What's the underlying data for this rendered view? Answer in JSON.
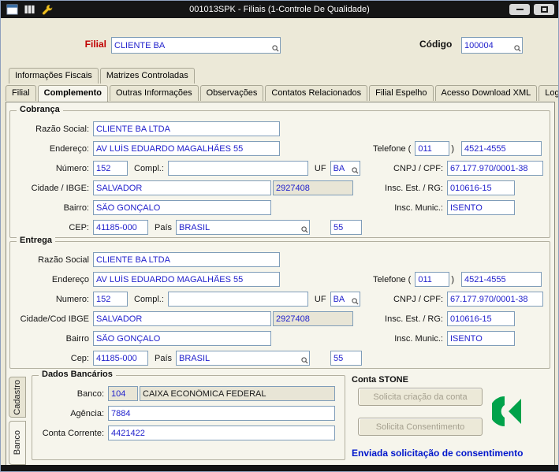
{
  "window": {
    "title": "001013SPK - Filiais (1-Controle De Qualidade)"
  },
  "icons": {
    "titlebar": [
      "app-window-icon",
      "columns-icon",
      "wrench-icon",
      "minimize-icon",
      "restore-icon"
    ],
    "field_lookup": "search-icon",
    "stone": "stone-green-icon"
  },
  "colors": {
    "filial_label": "#c00000",
    "field_value": "#2222cc",
    "stone_green": "#00a24a",
    "status_text": "#0016cc"
  },
  "header": {
    "filial": {
      "label": "Filial",
      "value": "CLIENTE BA"
    },
    "codigo": {
      "label": "Código",
      "value": "100004"
    }
  },
  "top_tabs": [
    {
      "label": "Informações Fiscais"
    },
    {
      "label": "Matrizes Controladas"
    }
  ],
  "main_tabs": [
    {
      "label": "Filial",
      "active": false
    },
    {
      "label": "Complemento",
      "active": true
    },
    {
      "label": "Outras Informações",
      "active": false
    },
    {
      "label": "Observações",
      "active": false
    },
    {
      "label": "Contatos Relacionados",
      "active": false
    },
    {
      "label": "Filial Espelho",
      "active": false
    },
    {
      "label": "Acesso Download XML",
      "active": false
    },
    {
      "label": "Log",
      "active": false
    }
  ],
  "cobranca": {
    "legend": "Cobrança",
    "razao": {
      "label": "Razão Social:",
      "value": "CLIENTE BA LTDA"
    },
    "endereco": {
      "label": "Endereço:",
      "value": "AV LUÍS EDUARDO MAGALHÃES 55"
    },
    "telefone": {
      "label": "Telefone (",
      "paren": ")",
      "ddd": "011",
      "numero": "4521-4555"
    },
    "numero": {
      "label": "Número:",
      "value": "152"
    },
    "compl": {
      "label": "Compl.:",
      "value": ""
    },
    "uf": {
      "label": "UF",
      "value": "BA"
    },
    "cnpj": {
      "label": "CNPJ / CPF:",
      "value": "67.177.970/0001-38"
    },
    "cidade": {
      "label": "Cidade / IBGE:",
      "value": "SALVADOR",
      "ibge": "2927408"
    },
    "insc_est": {
      "label": "Insc. Est. / RG:",
      "value": "010616-15"
    },
    "bairro": {
      "label": "Bairro:",
      "value": "SÃO GONÇALO"
    },
    "insc_mun": {
      "label": "Insc. Munic.:",
      "value": "ISENTO"
    },
    "cep": {
      "label": "CEP:",
      "value": "41185-000"
    },
    "pais": {
      "label": "País",
      "value": "BRASIL",
      "ddi": "55"
    }
  },
  "entrega": {
    "legend": "Entrega",
    "razao": {
      "label": "Razão Social",
      "value": "CLIENTE BA LTDA"
    },
    "endereco": {
      "label": "Endereço",
      "value": "AV LUÍS EDUARDO MAGALHÃES 55"
    },
    "telefone": {
      "label": "Telefone (",
      "paren": ")",
      "ddd": "011",
      "numero": "4521-4555"
    },
    "numero": {
      "label": "Numero:",
      "value": "152"
    },
    "compl": {
      "label": "Compl.:",
      "value": ""
    },
    "uf": {
      "label": "UF",
      "value": "BA"
    },
    "cnpj": {
      "label": "CNPJ / CPF:",
      "value": "67.177.970/0001-38"
    },
    "cidade": {
      "label": "Cidade/Cod IBGE",
      "value": "SALVADOR",
      "ibge": "2927408"
    },
    "insc_est": {
      "label": "Insc. Est. / RG:",
      "value": "010616-15"
    },
    "bairro": {
      "label": "Bairro",
      "value": "SÃO GONÇALO"
    },
    "insc_mun": {
      "label": "Insc. Munic.:",
      "value": "ISENTO"
    },
    "cep": {
      "label": "Cep:",
      "value": "41185-000"
    },
    "pais": {
      "label": "País",
      "value": "BRASIL",
      "ddi": "55"
    }
  },
  "side_tabs": [
    {
      "label": "Cadastro",
      "active": false
    },
    {
      "label": "Banco",
      "active": true
    }
  ],
  "dados_bancarios": {
    "legend": "Dados Bancários",
    "banco": {
      "label": "Banco:",
      "code": "104",
      "name": "CAIXA ECONÔMICA FEDERAL"
    },
    "agencia": {
      "label": "Agência:",
      "value": "7884"
    },
    "conta_corrente": {
      "label": "Conta Corrente:",
      "value": "4421422"
    }
  },
  "conta_stone": {
    "title": "Conta STONE",
    "solicita_criacao_label": "Solicita criação da conta",
    "solicita_consentimento_label": "Solicita Consentimento",
    "status": "Enviada solicitação de consentimento"
  }
}
